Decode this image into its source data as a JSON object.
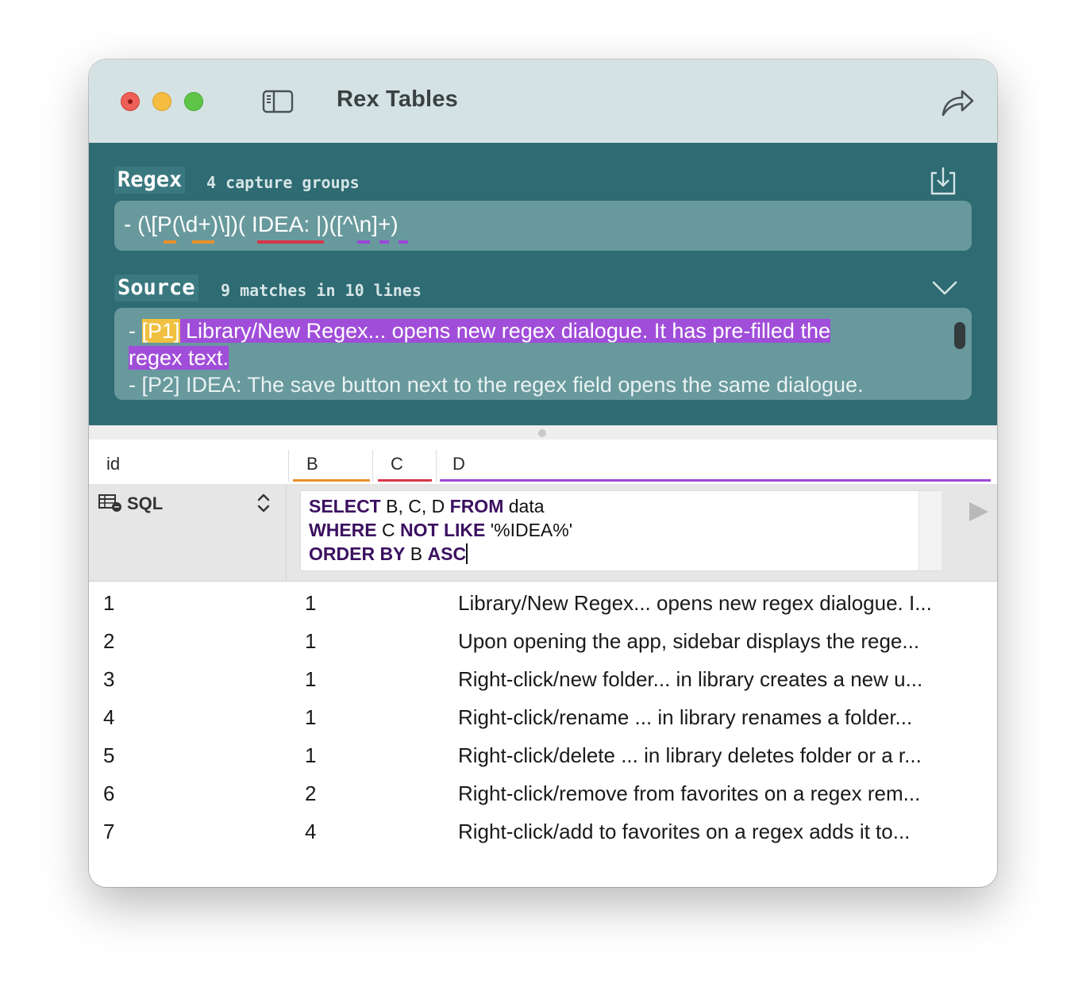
{
  "window": {
    "title": "Rex Tables"
  },
  "regex": {
    "label": "Regex",
    "capture_info": "4 capture groups",
    "pattern_parts": [
      "- (\\[",
      "P",
      "(\\d+)",
      "\\])(",
      " IDEA: |",
      ")(",
      "[^\\n]",
      "+)"
    ]
  },
  "source": {
    "label": "Source",
    "match_info": "9 matches in 10 lines",
    "lines": [
      {
        "prefix": "- ",
        "tag": "[P1]",
        "text": " Library/New Regex... opens new regex dialogue. It has pre-filled the"
      },
      {
        "prefix": "",
        "tag": "",
        "text": "regex text."
      },
      {
        "prefix": "- ",
        "tag": "",
        "text": "[P2] IDEA: The save button next to the regex field opens the same dialogue."
      }
    ]
  },
  "columns": [
    {
      "name": "id"
    },
    {
      "name": "B",
      "color": "#e8902b"
    },
    {
      "name": "C",
      "color": "#d8364a"
    },
    {
      "name": "D",
      "color": "#9b47d6"
    }
  ],
  "sql": {
    "mode_label": "SQL",
    "query_lines": [
      [
        {
          "t": "SELECT",
          "kw": true
        },
        {
          "t": " B, C, D ",
          "kw": false
        },
        {
          "t": "FROM",
          "kw": true
        },
        {
          "t": " data",
          "kw": false
        }
      ],
      [
        {
          "t": "WHERE",
          "kw": true
        },
        {
          "t": " C ",
          "kw": false
        },
        {
          "t": "NOT LIKE",
          "kw": true
        },
        {
          "t": " '%IDEA%'",
          "kw": false
        }
      ],
      [
        {
          "t": "ORDER BY",
          "kw": true
        },
        {
          "t": " B ",
          "kw": false
        },
        {
          "t": "ASC",
          "kw": true
        }
      ]
    ]
  },
  "rows": [
    {
      "id": "1",
      "b": "1",
      "d": "Library/New Regex... opens new regex dialogue. I..."
    },
    {
      "id": "2",
      "b": "1",
      "d": "Upon opening the app, sidebar displays the rege..."
    },
    {
      "id": "3",
      "b": "1",
      "d": "Right-click/new folder... in library creates a new u..."
    },
    {
      "id": "4",
      "b": "1",
      "d": "Right-click/rename ... in library renames a folder..."
    },
    {
      "id": "5",
      "b": "1",
      "d": "Right-click/delete ... in library deletes folder or a r..."
    },
    {
      "id": "6",
      "b": "2",
      "d": "Right-click/remove from favorites on a regex rem..."
    },
    {
      "id": "7",
      "b": "4",
      "d": " Right-click/add to favorites on a regex adds it to..."
    }
  ]
}
